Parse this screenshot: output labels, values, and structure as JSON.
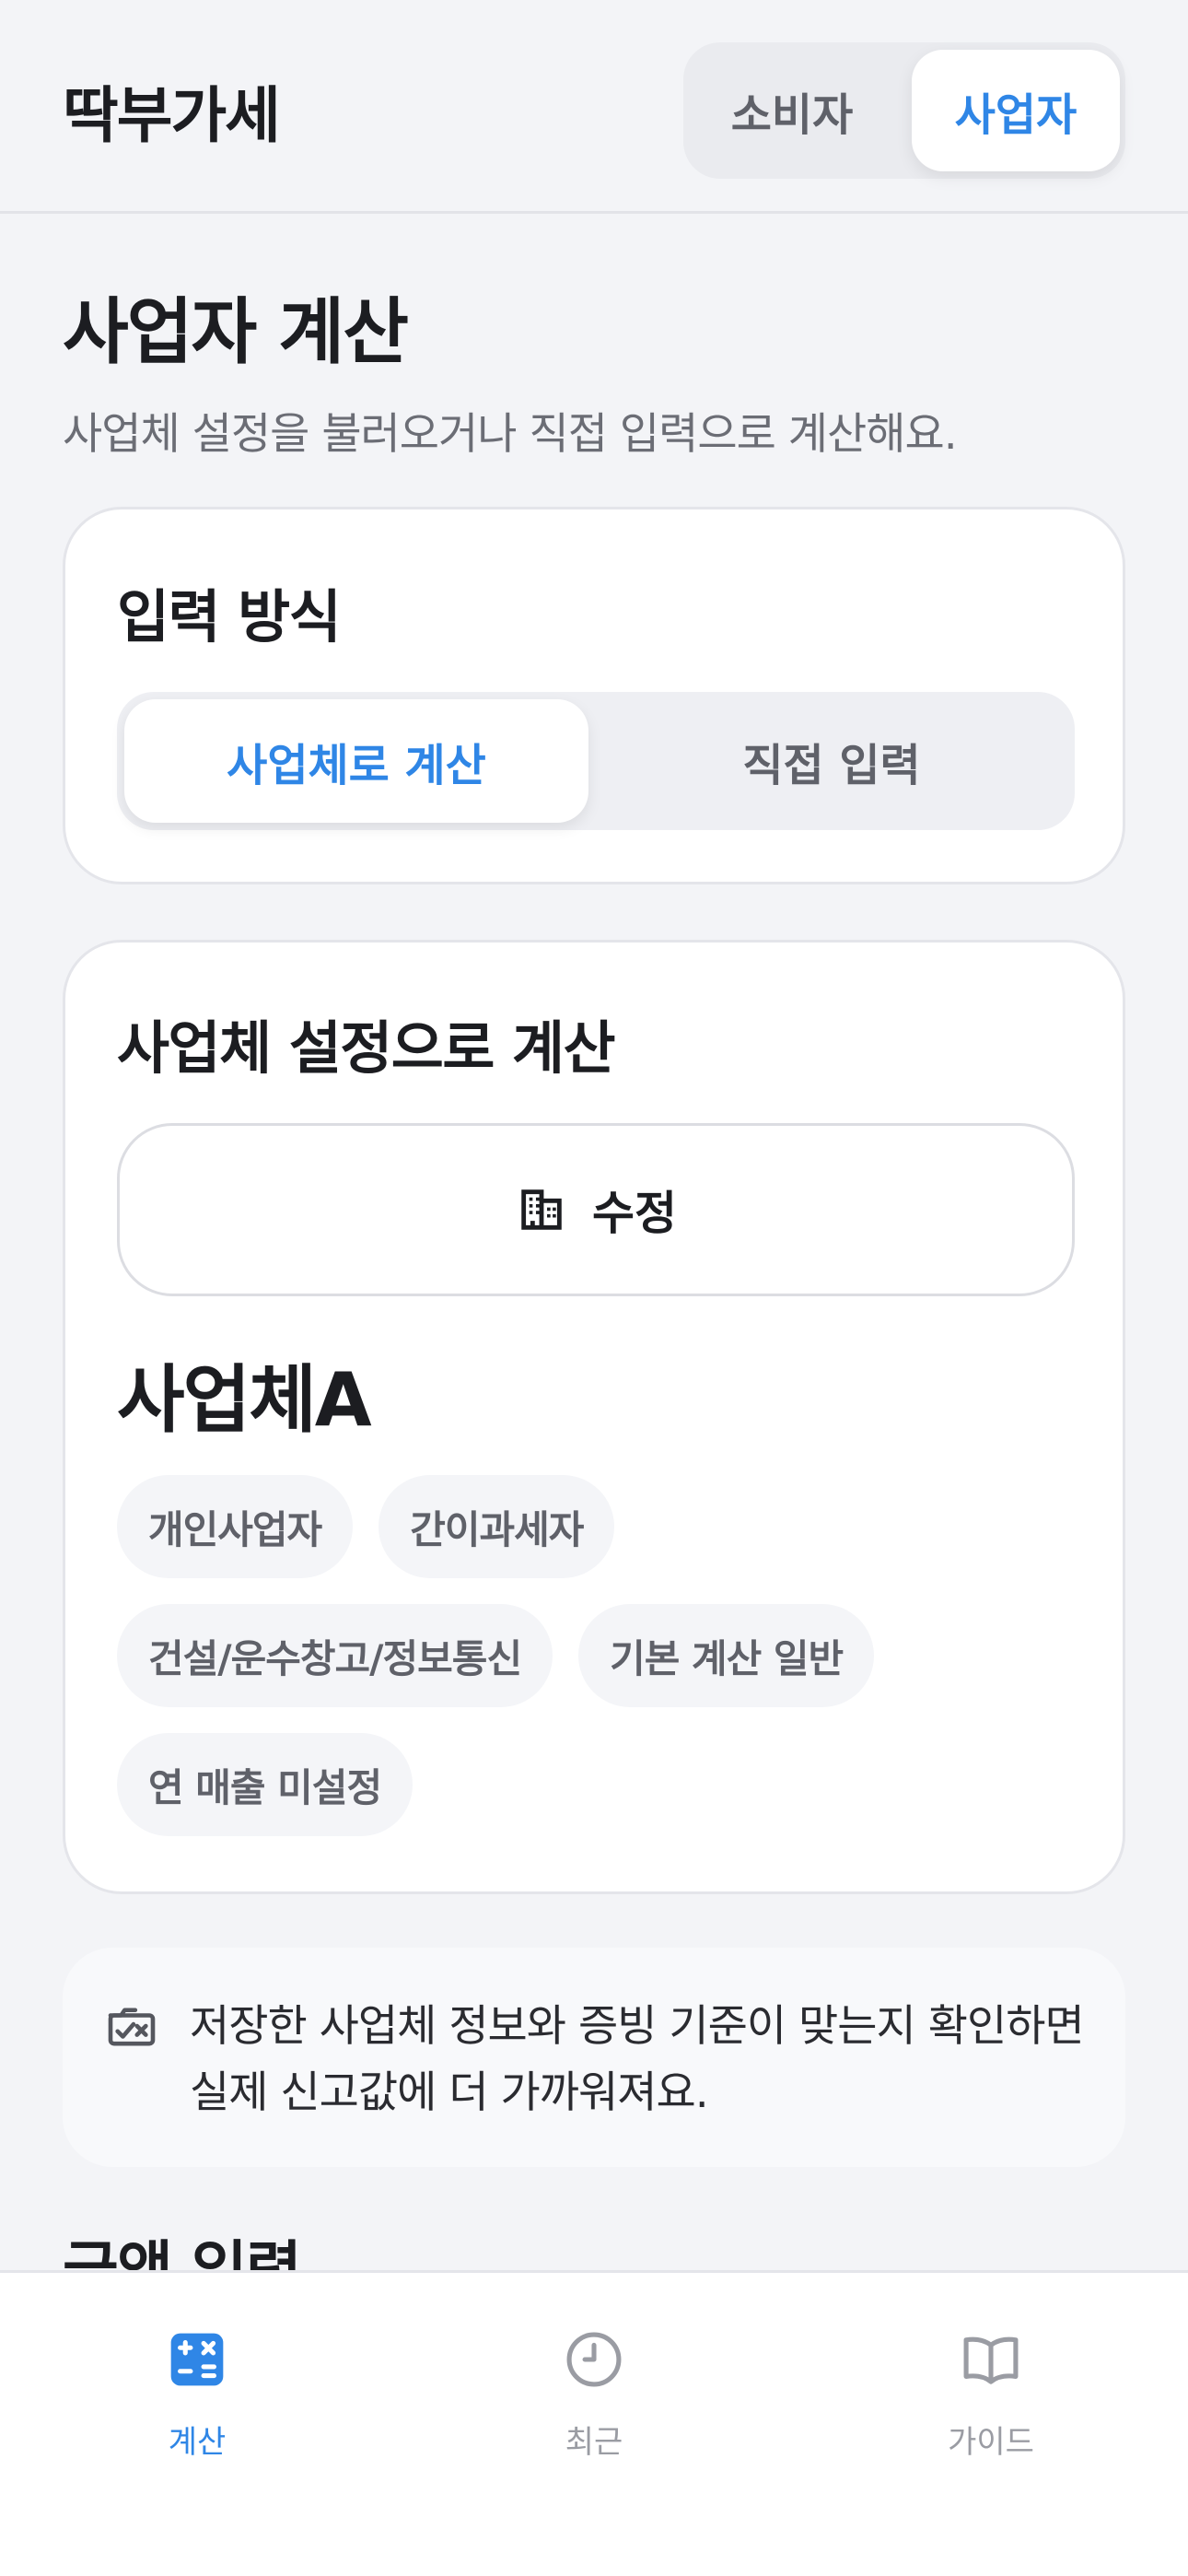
{
  "header": {
    "app_title": "딱부가세",
    "mode_options": [
      "소비자",
      "사업자"
    ],
    "selected_mode": "사업자"
  },
  "page": {
    "title": "사업자 계산",
    "subtitle": "사업체 설정을 불러오거나 직접 입력으로 계산해요."
  },
  "input_method": {
    "heading": "입력 방식",
    "options": [
      "사업체로 계산",
      "직접 입력"
    ],
    "selected": "사업체로 계산"
  },
  "business_calc": {
    "heading": "사업체 설정으로 계산",
    "edit_label": "수정",
    "edit_icon": "building-icon",
    "business_name": "사업체A",
    "tags": [
      "개인사업자",
      "간이과세자",
      "건설/운수창고/정보통신",
      "기본 계산 일반",
      "연 매출 미설정"
    ]
  },
  "notice": {
    "icon": "checked-box-icon",
    "text": "저장한 사업체 정보와 증빙 기준이 맞는지 확인하면 실제 신고값에 더 가까워져요."
  },
  "next_section": {
    "heading": "금액 입력"
  },
  "tabbar": {
    "tabs": [
      {
        "label": "계산",
        "icon": "calculator-icon",
        "active": true
      },
      {
        "label": "최근",
        "icon": "clock-icon",
        "active": false
      },
      {
        "label": "가이드",
        "icon": "book-icon",
        "active": false
      }
    ]
  },
  "colors": {
    "accent": "#2f86e6",
    "background": "#f3f4f7",
    "card": "#ffffff",
    "chip": "#f4f5f8",
    "muted_text": "#5f6169"
  }
}
